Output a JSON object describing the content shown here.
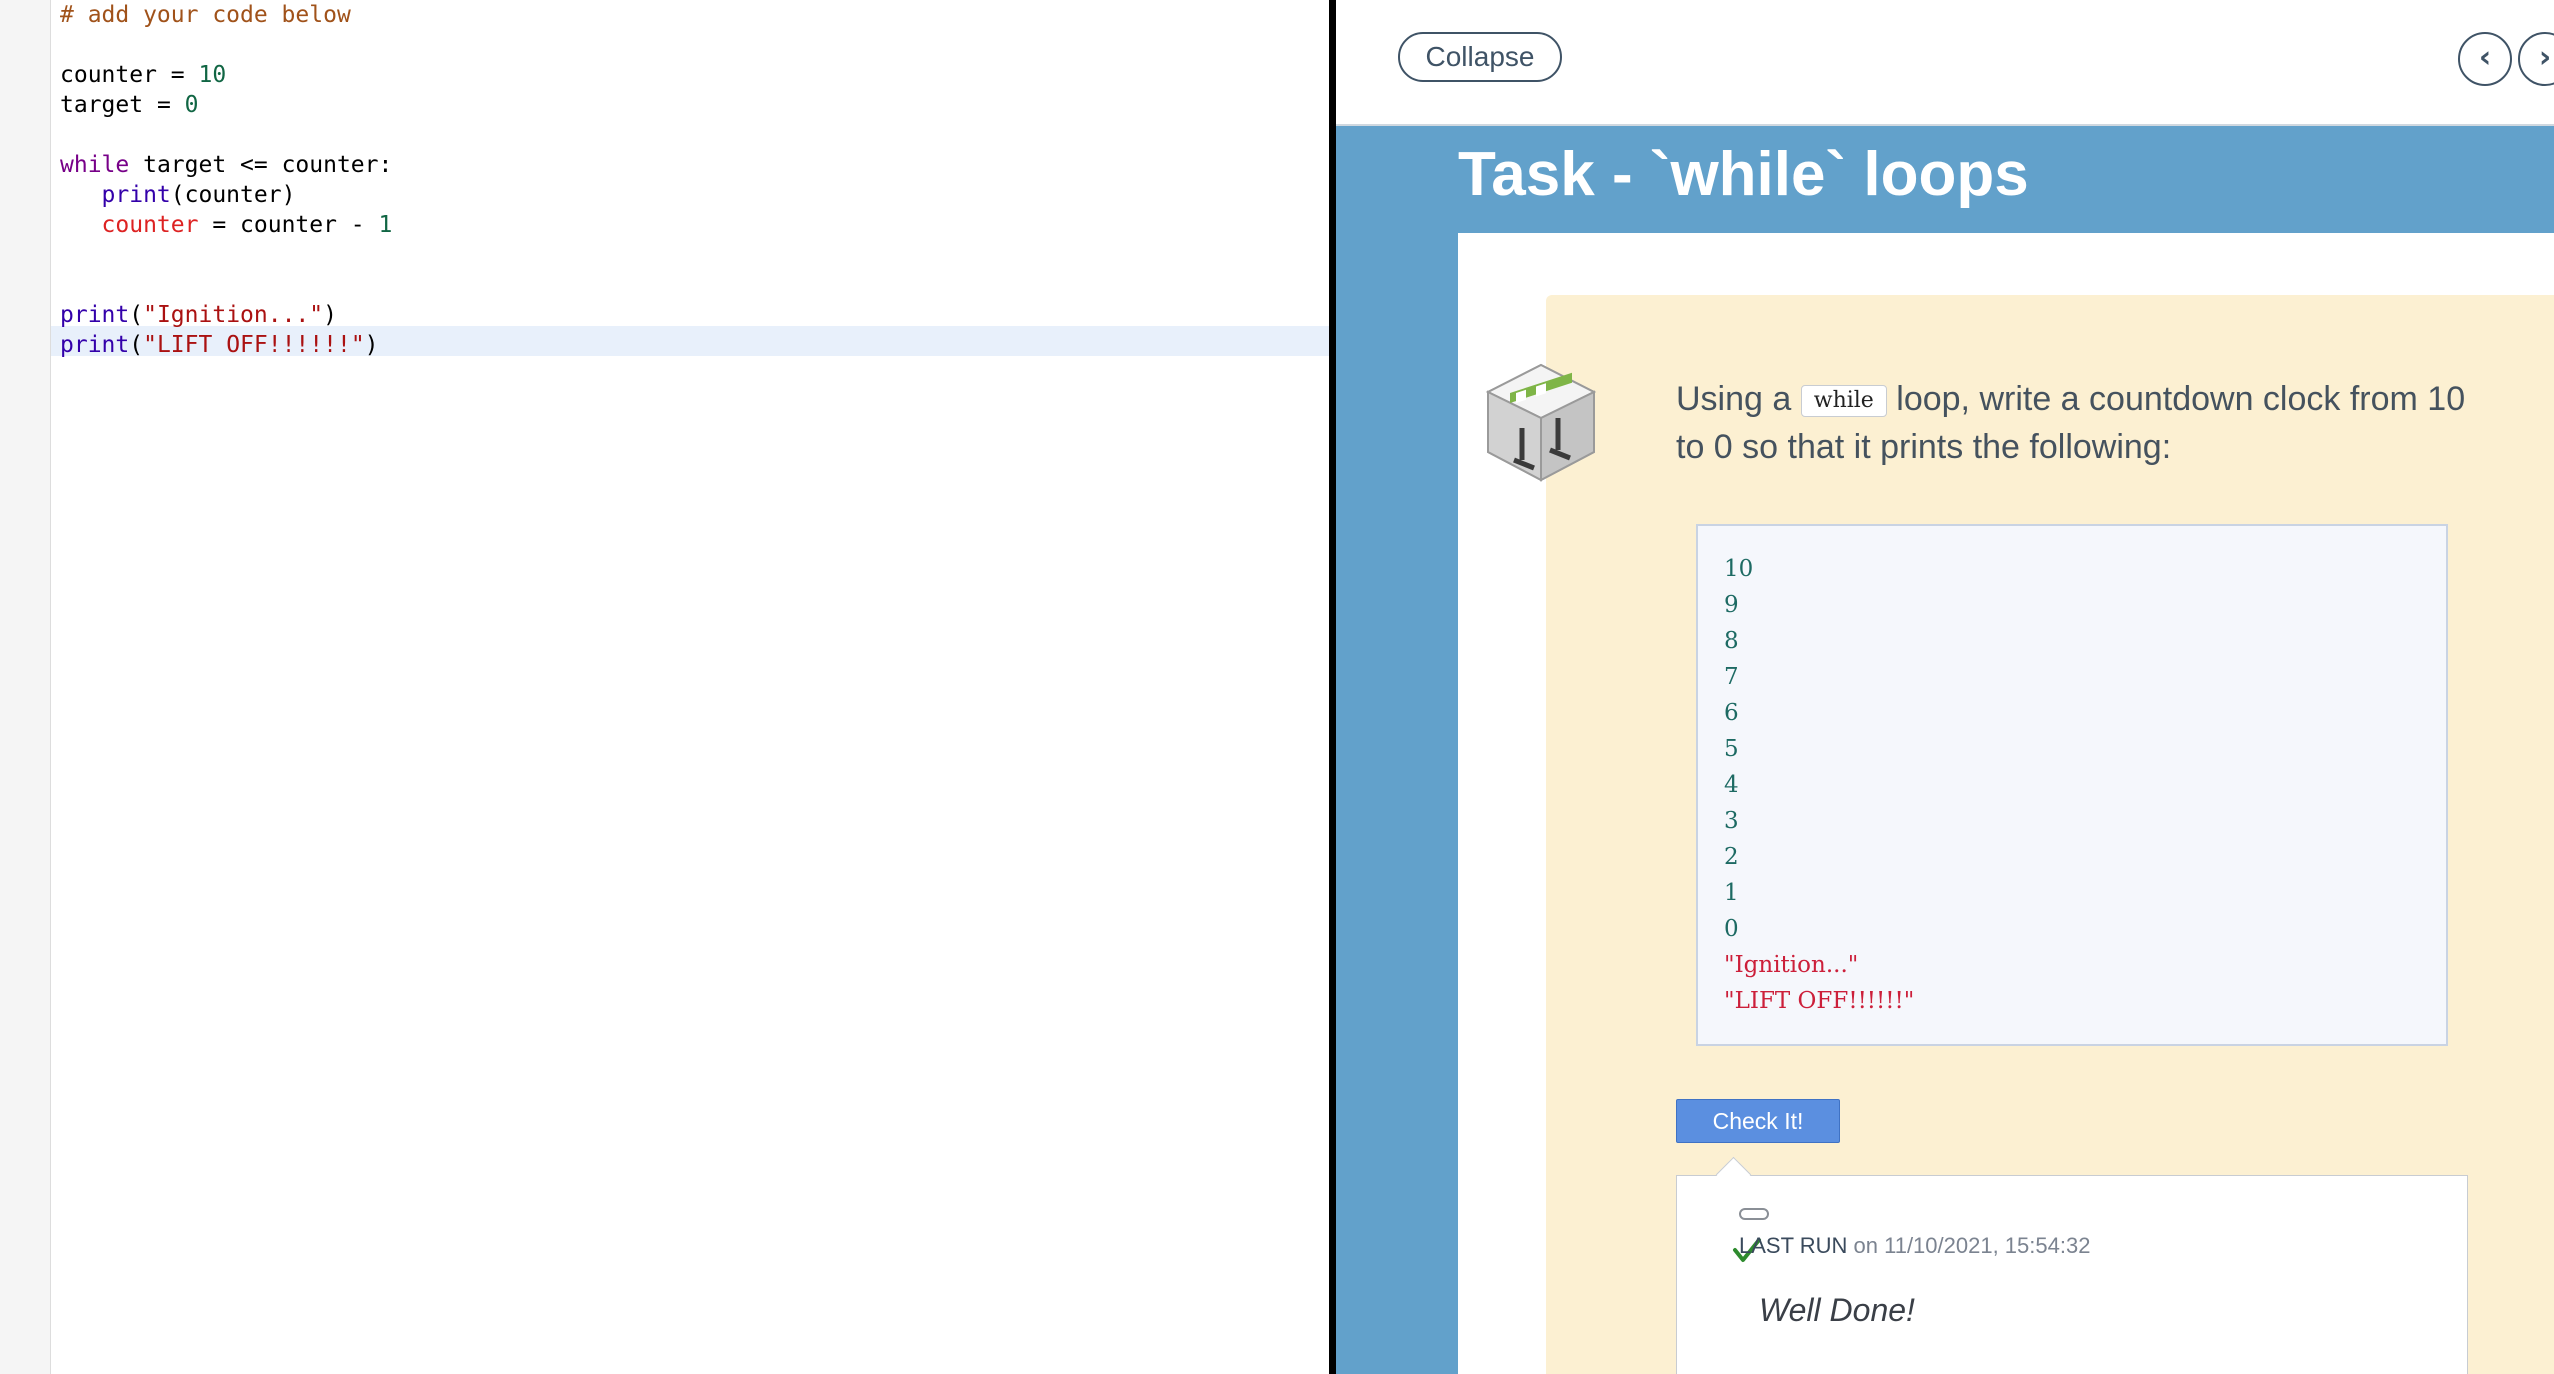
{
  "editor": {
    "lines": [
      [
        {
          "t": "# add your code below",
          "c": "c-com"
        }
      ],
      [],
      [
        {
          "t": "counter",
          "c": ""
        },
        {
          "t": " = ",
          "c": ""
        },
        {
          "t": "10",
          "c": "c-num"
        }
      ],
      [
        {
          "t": "target",
          "c": ""
        },
        {
          "t": " = ",
          "c": ""
        },
        {
          "t": "0",
          "c": "c-num"
        }
      ],
      [],
      [
        {
          "t": "while",
          "c": "c-kw"
        },
        {
          "t": " target <= counter:",
          "c": ""
        }
      ],
      [
        {
          "t": "   ",
          "c": ""
        },
        {
          "t": "print",
          "c": "c-bi"
        },
        {
          "t": "(counter)",
          "c": ""
        }
      ],
      [
        {
          "t": "   ",
          "c": ""
        },
        {
          "t": "counter",
          "c": "c-var"
        },
        {
          "t": " = counter - ",
          "c": ""
        },
        {
          "t": "1",
          "c": "c-num"
        }
      ],
      [],
      [],
      [
        {
          "t": "print",
          "c": "c-bi"
        },
        {
          "t": "(",
          "c": ""
        },
        {
          "t": "\"Ignition...\"",
          "c": "c-str"
        },
        {
          "t": ")",
          "c": ""
        }
      ],
      [
        {
          "t": "print",
          "c": "c-bi"
        },
        {
          "t": "(",
          "c": ""
        },
        {
          "t": "\"LIFT OFF!!!!!!\"",
          "c": "c-str"
        },
        {
          "t": ")",
          "c": ""
        }
      ]
    ]
  },
  "topbar": {
    "collapse_label": "Collapse",
    "prev_icon": "‹",
    "next_icon": "›"
  },
  "task": {
    "title": "Task - `while` loops",
    "icon": "hurdle-icon",
    "instruction_before": "Using a ",
    "inline_code": "while",
    "instruction_after": " loop, write a countdown clock from 10 to 0 so that it prints the following:",
    "expected_output": [
      {
        "text": "10",
        "kind": "num"
      },
      {
        "text": "9",
        "kind": "num"
      },
      {
        "text": "8",
        "kind": "num"
      },
      {
        "text": "7",
        "kind": "num"
      },
      {
        "text": "6",
        "kind": "num"
      },
      {
        "text": "5",
        "kind": "num"
      },
      {
        "text": "4",
        "kind": "num"
      },
      {
        "text": "3",
        "kind": "num"
      },
      {
        "text": "2",
        "kind": "num"
      },
      {
        "text": "1",
        "kind": "num"
      },
      {
        "text": "0",
        "kind": "num"
      },
      {
        "text": "\"Ignition...\"",
        "kind": "str"
      },
      {
        "text": "\"LIFT OFF!!!!!!\"",
        "kind": "str"
      }
    ],
    "check_button_label": "Check It!"
  },
  "result": {
    "status_icon": "check-icon",
    "last_run_label": "LAST RUN",
    "last_run_meta": " on 11/10/2021, 15:54:32",
    "message": "Well Done!"
  },
  "colors": {
    "panel_background": "#62a1cb",
    "card_background": "#fcf0d2",
    "check_button": "#5b8fe0",
    "success": "#2e8b2e"
  }
}
